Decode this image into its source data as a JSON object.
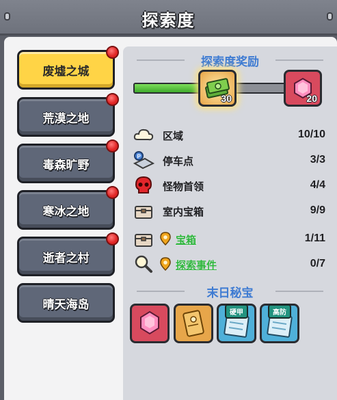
{
  "header": {
    "title": "探索度"
  },
  "tabs": [
    {
      "label": "废墟之城",
      "active": true,
      "badge": true
    },
    {
      "label": "荒漠之地",
      "active": false,
      "badge": true
    },
    {
      "label": "毒森旷野",
      "active": false,
      "badge": true
    },
    {
      "label": "寒冰之地",
      "active": false,
      "badge": true
    },
    {
      "label": "逝者之村",
      "active": false,
      "badge": true
    },
    {
      "label": "晴天海岛",
      "active": false,
      "badge": false
    }
  ],
  "rewards": {
    "title": "探索度奖励",
    "progress_fraction": 0.55,
    "milestones": [
      {
        "icon": "cash-bundle-icon",
        "count": "30"
      },
      {
        "icon": "pink-gem-icon",
        "count": "20"
      }
    ]
  },
  "stats": [
    {
      "icon": "cloud-icon",
      "label": "区域",
      "value": "10/10",
      "has_pin": false,
      "is_link": false
    },
    {
      "icon": "parking-icon",
      "label": "停车点",
      "value": "3/3",
      "has_pin": false,
      "is_link": false
    },
    {
      "icon": "red-skull-icon",
      "label": "怪物首领",
      "value": "4/4",
      "has_pin": false,
      "is_link": false
    },
    {
      "icon": "chest-icon",
      "label": "室内宝箱",
      "value": "9/9",
      "has_pin": false,
      "is_link": false
    },
    {
      "icon": "chest-icon",
      "label": "宝箱",
      "value": "1/11",
      "has_pin": true,
      "is_link": true
    },
    {
      "icon": "magnifier-icon",
      "label": "探索事件",
      "value": "0/7",
      "has_pin": true,
      "is_link": true
    }
  ],
  "treasure": {
    "title": "末日秘宝",
    "items": [
      {
        "icon": "pink-gem-icon",
        "tag": ""
      },
      {
        "icon": "gold-card-icon",
        "tag": ""
      },
      {
        "icon": "blueprint-icon",
        "tag": "硬甲"
      },
      {
        "icon": "blueprint-icon",
        "tag": "高防"
      }
    ]
  },
  "colors": {
    "accent_blue": "#3e7bd2",
    "link_green": "#2fb63d",
    "active_tab": "#ffd446",
    "inactive_tab": "#5f6778"
  }
}
